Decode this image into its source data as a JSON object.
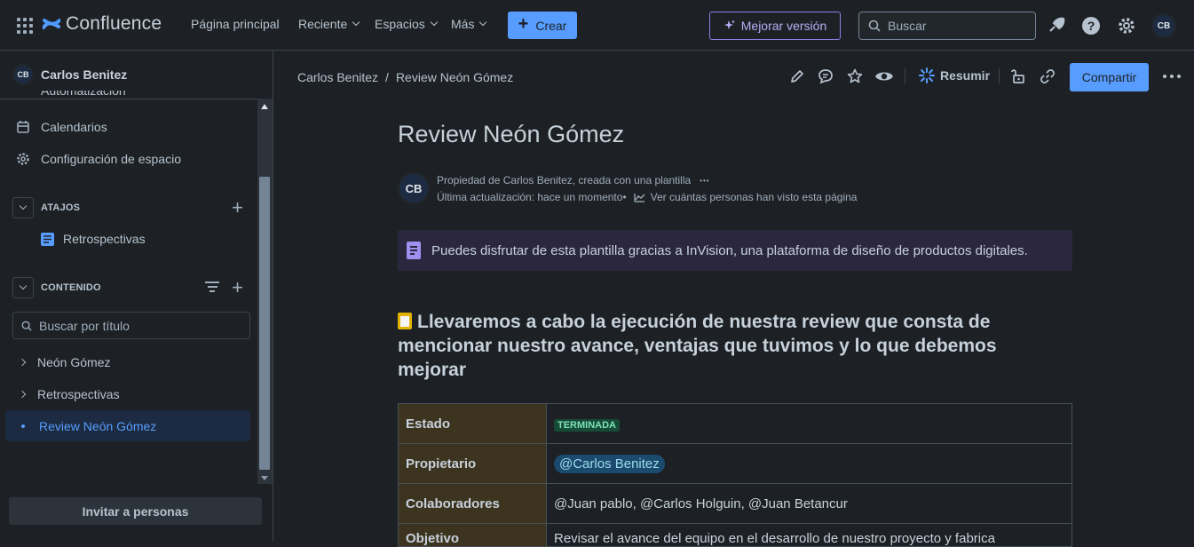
{
  "topbar": {
    "app_name": "Confluence",
    "nav": [
      "Página principal",
      "Reciente",
      "Espacios",
      "Más"
    ],
    "create_label": "Crear",
    "upgrade_label": "Mejorar versión",
    "search_placeholder": "Buscar",
    "avatar_initials": "CB"
  },
  "sidebar": {
    "space_owner": "Carlos Benitez",
    "avatar_initials": "CB",
    "cut_item": "Automatización",
    "items": [
      "Calendarios",
      "Configuración de espacio"
    ],
    "shortcuts_label": "ATAJOS",
    "shortcut_item": "Retrospectivas",
    "content_label": "CONTENIDO",
    "search_placeholder": "Buscar por título",
    "tree": [
      "Neón Gómez",
      "Retrospectivas"
    ],
    "active": "Review Neón Gómez",
    "invite_label": "Invitar a personas"
  },
  "page": {
    "breadcrumb": [
      "Carlos Benitez",
      "Review Neón Gómez"
    ],
    "breadcrumb_sep": "/",
    "summarize_label": "Resumir",
    "share_label": "Compartir",
    "title": "Review Neón Gómez",
    "byline_avatar": "CB",
    "byline_owner": "Propiedad de Carlos Benitez, creada con una plantilla",
    "byline_more": "•••",
    "byline_updated": "Última actualización: hace un momento•",
    "byline_views": "Ver cuántas personas han visto esta página",
    "panel_text": "Puedes disfrutar de esta plantilla gracias a InVision, una plataforma de diseño de productos digitales.",
    "heading": "Llevaremos a cabo la ejecución de nuestra review que consta de mencionar nuestro avance, ventajas que tuvimos y lo que debemos mejorar",
    "table": {
      "estado_label": "Estado",
      "estado_value": "TERMINADA",
      "propietario_label": "Propietario",
      "propietario_value": "@Carlos Benitez",
      "colaboradores_label": "Colaboradores",
      "colaboradores_value": "@Juan pablo, @Carlos Holguin, @Juan Betancur",
      "objetivo_label": "Objetivo",
      "objetivo_value": "Revisar el avance del equipo en el desarrollo de nuestro proyecto y fabrica"
    }
  },
  "colors": {
    "accent": "#579dff",
    "background": "#1d2125",
    "upgrade": "#8f7ee7"
  }
}
